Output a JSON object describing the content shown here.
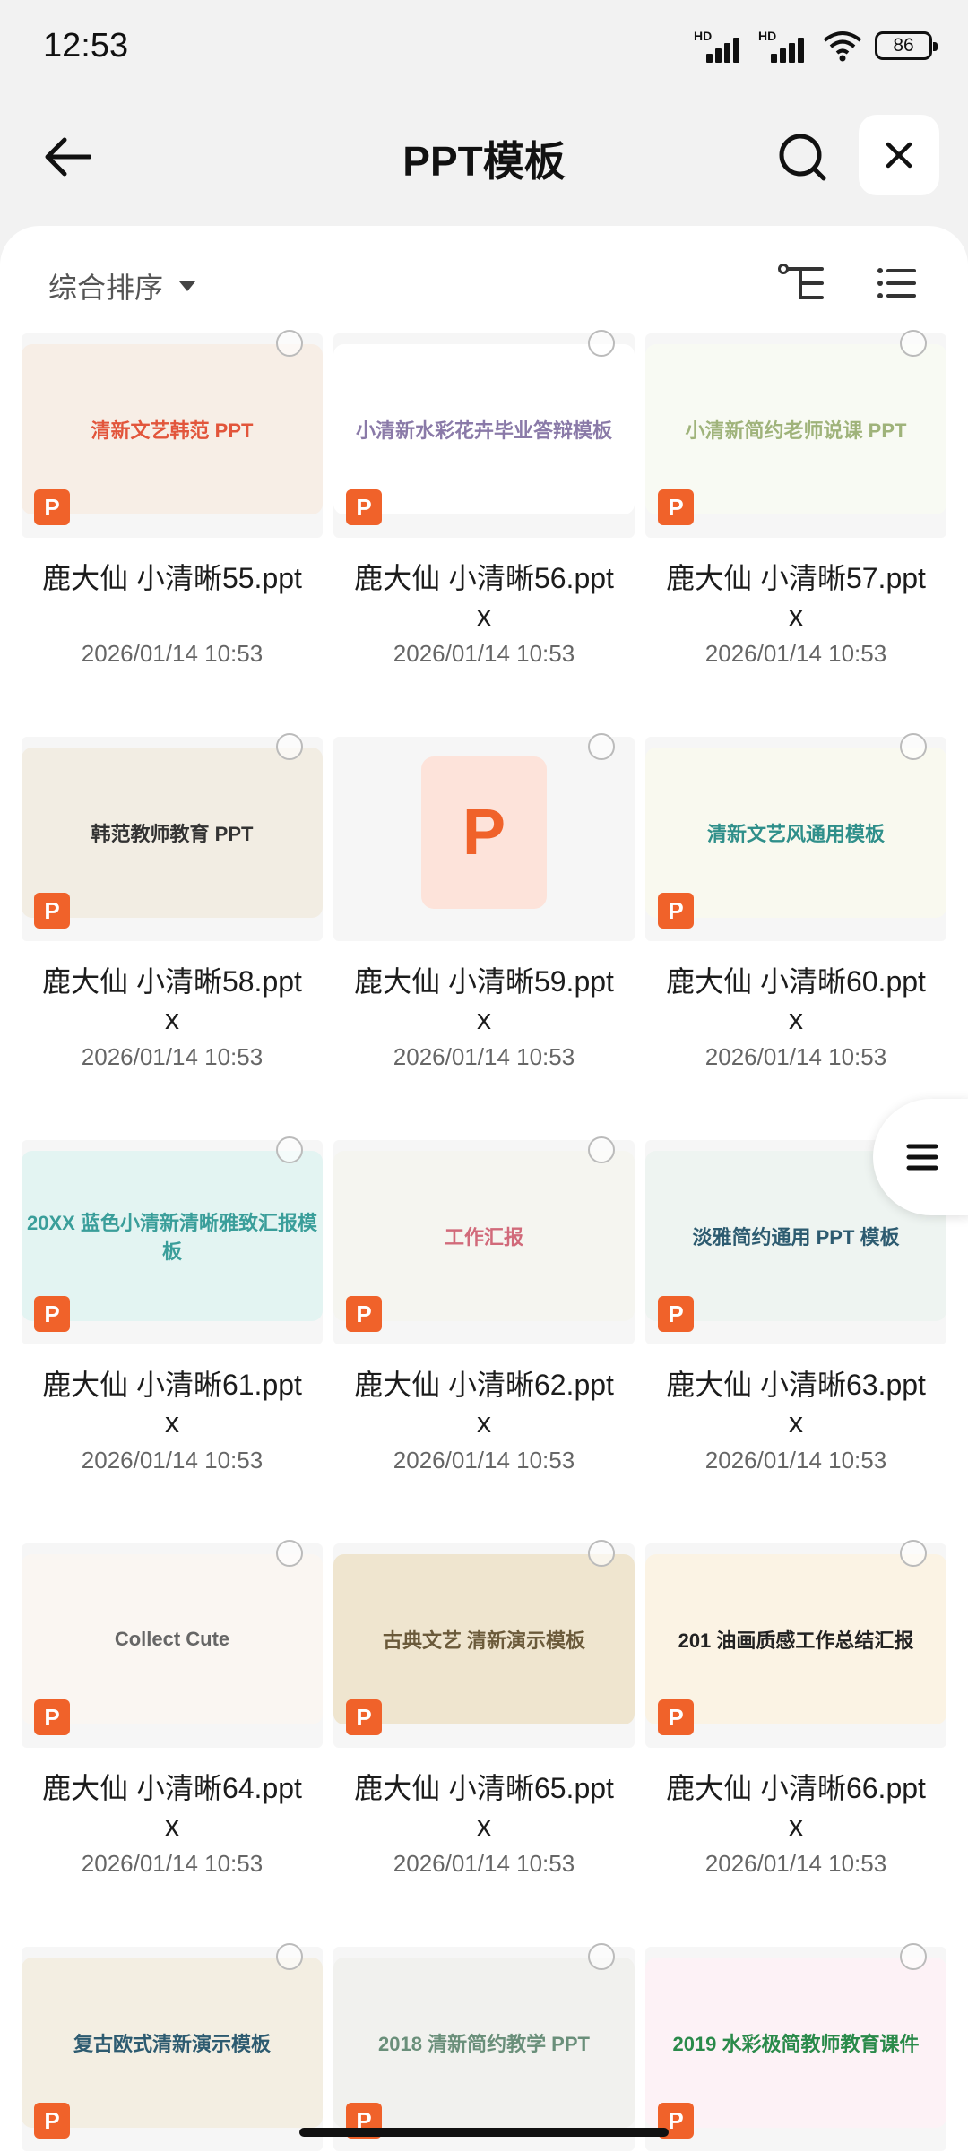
{
  "status": {
    "time": "12:53",
    "battery": "86",
    "sim1": "HD",
    "sim2": "HD"
  },
  "header": {
    "title": "PPT模板"
  },
  "sort": {
    "label": "综合排序"
  },
  "files": [
    {
      "name": "鹿大仙 小清晰55.ppt",
      "date": "2026/01/14 10:53",
      "thumb_title": "清新文艺韩范 PPT",
      "thumb_bg": "#f7eee6",
      "thumb_fg": "#e2553b"
    },
    {
      "name": "鹿大仙 小清晰56.pptx",
      "date": "2026/01/14 10:53",
      "thumb_title": "小清新水彩花卉毕业答辩模板",
      "thumb_bg": "#ffffff",
      "thumb_fg": "#8a7aa8"
    },
    {
      "name": "鹿大仙 小清晰57.pptx",
      "date": "2026/01/14 10:53",
      "thumb_title": "小清新简约老师说课 PPT",
      "thumb_bg": "#f8faf3",
      "thumb_fg": "#9fb37a"
    },
    {
      "name": "鹿大仙 小清晰58.pptx",
      "date": "2026/01/14 10:53",
      "thumb_title": "韩范教师教育 PPT",
      "thumb_bg": "#f2ede3",
      "thumb_fg": "#333333"
    },
    {
      "name": "鹿大仙 小清晰59.pptx",
      "date": "2026/01/14 10:53",
      "thumb_title": "",
      "thumb_bg": "#f6f6f6",
      "thumb_fg": "#f0622a",
      "placeholder": true
    },
    {
      "name": "鹿大仙 小清晰60.pptx",
      "date": "2026/01/14 10:53",
      "thumb_title": "清新文艺风通用模板",
      "thumb_bg": "#f9f9ef",
      "thumb_fg": "#2f8f8a"
    },
    {
      "name": "鹿大仙 小清晰61.pptx",
      "date": "2026/01/14 10:53",
      "thumb_title": "20XX 蓝色小清新清晰雅致汇报模板",
      "thumb_bg": "#e3f4f2",
      "thumb_fg": "#3a9e9a"
    },
    {
      "name": "鹿大仙 小清晰62.pptx",
      "date": "2026/01/14 10:53",
      "thumb_title": "工作汇报",
      "thumb_bg": "#f5f5f0",
      "thumb_fg": "#d16a7a"
    },
    {
      "name": "鹿大仙 小清晰63.pptx",
      "date": "2026/01/14 10:53",
      "thumb_title": "淡雅简约通用 PPT 模板",
      "thumb_bg": "#eef4f1",
      "thumb_fg": "#2d5b70"
    },
    {
      "name": "鹿大仙 小清晰64.pptx",
      "date": "2026/01/14 10:53",
      "thumb_title": "Collect Cute",
      "thumb_bg": "#faf6f2",
      "thumb_fg": "#666666"
    },
    {
      "name": "鹿大仙 小清晰65.pptx",
      "date": "2026/01/14 10:53",
      "thumb_title": "古典文艺 清新演示模板",
      "thumb_bg": "#efe5cf",
      "thumb_fg": "#6b5a3a"
    },
    {
      "name": "鹿大仙 小清晰66.pptx",
      "date": "2026/01/14 10:53",
      "thumb_title": "201 油画质感工作总结汇报",
      "thumb_bg": "#fbf3e4",
      "thumb_fg": "#222222"
    },
    {
      "name": "",
      "date": "",
      "thumb_title": "复古欧式清新演示模板",
      "thumb_bg": "#f3eee2",
      "thumb_fg": "#2d5b70"
    },
    {
      "name": "",
      "date": "",
      "thumb_title": "2018 清新简约教学 PPT",
      "thumb_bg": "#f1f1ee",
      "thumb_fg": "#6a8f7a"
    },
    {
      "name": "",
      "date": "",
      "thumb_title": "2019 水彩极简教师教育课件",
      "thumb_bg": "#fdf2f6",
      "thumb_fg": "#2a8a4a"
    }
  ]
}
